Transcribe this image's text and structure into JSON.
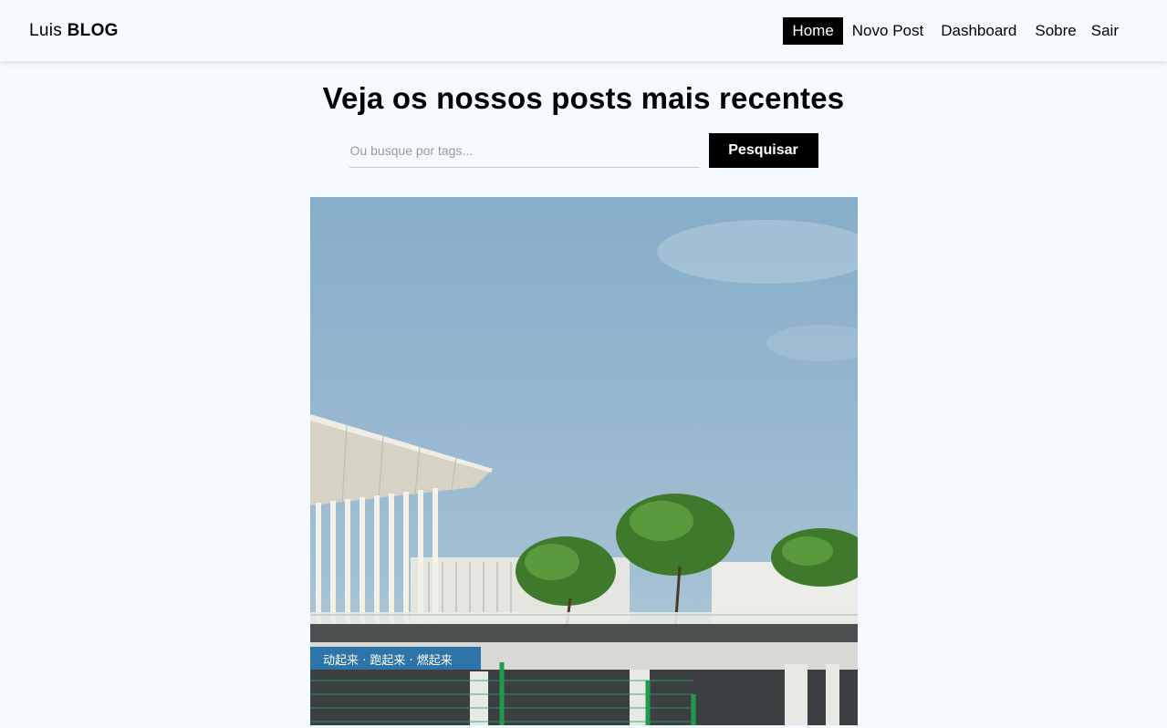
{
  "navbar": {
    "brand_prefix": "Luis",
    "brand_bold": "BLOG",
    "links": [
      {
        "label": "Home",
        "active": true
      },
      {
        "label": "Novo Post",
        "active": false
      },
      {
        "label": "Dashboard",
        "active": false
      },
      {
        "label": "Sobre",
        "active": false
      },
      {
        "label": "Sair",
        "active": false
      }
    ]
  },
  "home": {
    "title": "Veja os nossos posts mais recentes",
    "search": {
      "placeholder": "Ou busque por tags...",
      "value": "",
      "button_label": "Pesquisar"
    },
    "post": {
      "banner_text": "动起来 · 跑起来 · 燃起来"
    }
  },
  "colors": {
    "background": "#f5faff",
    "accent": "#000000",
    "sky": "#8fb3cc"
  }
}
